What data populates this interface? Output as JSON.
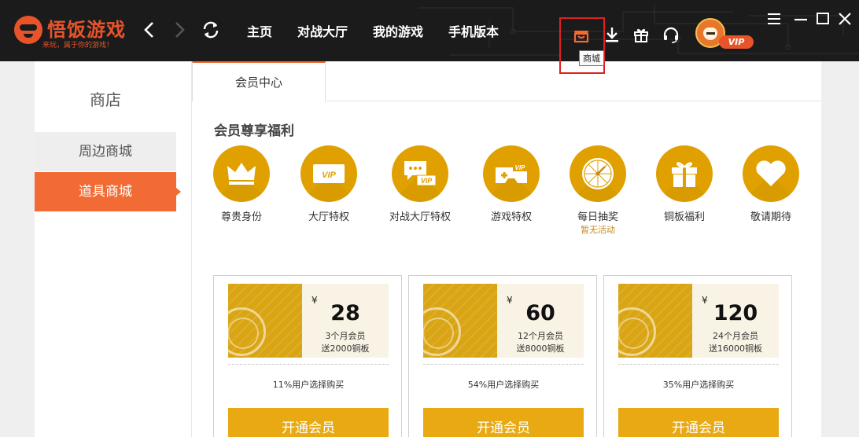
{
  "app": {
    "name": "悟饭游戏",
    "slogan": "来玩，属于你的游戏！"
  },
  "nav": {
    "items": [
      "主页",
      "对战大厅",
      "我的游戏",
      "手机版本"
    ]
  },
  "toolbar": {
    "icons": [
      "shop-icon",
      "download-icon",
      "gift-icon",
      "headset-icon"
    ],
    "tooltip": "商城",
    "vip_label": "VIP"
  },
  "sidebar": {
    "title": "商店",
    "items": [
      {
        "label": "周边商城",
        "active": false
      },
      {
        "label": "道具商城",
        "active": true
      }
    ]
  },
  "tabs": [
    {
      "label": "会员中心",
      "active": true
    }
  ],
  "benefits_section": {
    "title": "会员尊享福利",
    "items": [
      {
        "label": "尊贵身份",
        "icon": "crown-icon",
        "sub": ""
      },
      {
        "label": "大厅特权",
        "icon": "lobby-vip-icon",
        "sub": ""
      },
      {
        "label": "对战大厅特权",
        "icon": "chat-vip-icon",
        "sub": ""
      },
      {
        "label": "游戏特权",
        "icon": "gamepad-vip-icon",
        "sub": ""
      },
      {
        "label": "每日抽奖",
        "icon": "lottery-wheel-icon",
        "sub": "暂无活动"
      },
      {
        "label": "铜板福利",
        "icon": "gift-box-icon",
        "sub": ""
      },
      {
        "label": "敬请期待",
        "icon": "heart-icon",
        "sub": ""
      }
    ]
  },
  "plans": [
    {
      "currency": "¥",
      "price": "28",
      "months": "3个月会员",
      "bonus": "送2000铜板",
      "popularity": "11%用户选择购买",
      "button": "开通会员"
    },
    {
      "currency": "¥",
      "price": "60",
      "months": "12个月会员",
      "bonus": "送8000铜板",
      "popularity": "54%用户选择购买",
      "button": "开通会员"
    },
    {
      "currency": "¥",
      "price": "120",
      "months": "24个月会员",
      "bonus": "送16000铜板",
      "popularity": "35%用户选择购买",
      "button": "开通会员"
    }
  ],
  "colors": {
    "accent": "#f26b34",
    "gold": "#e0a100",
    "topbar": "#1b1b1b",
    "highlight": "#e02020"
  }
}
